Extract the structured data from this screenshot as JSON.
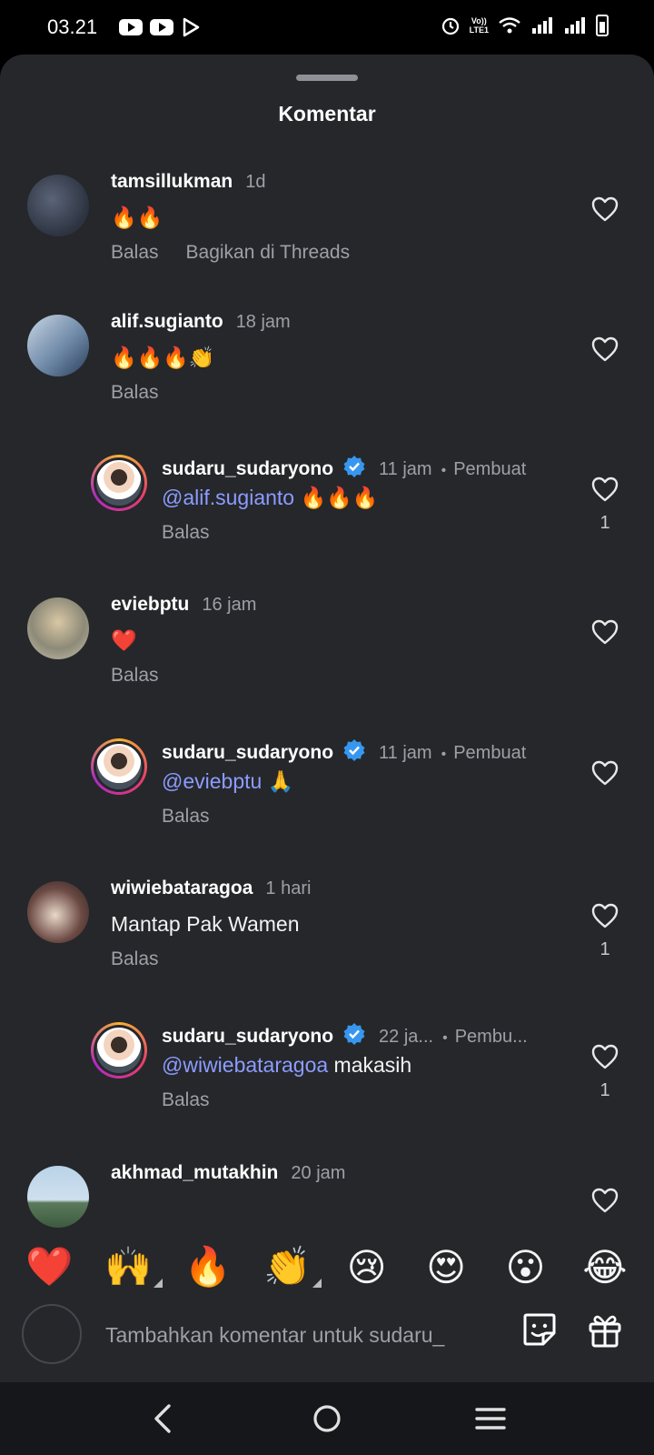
{
  "status_bar": {
    "time": "03.21",
    "lte_label_top": "Vo))",
    "lte_label_bottom": "LTE1"
  },
  "sheet": {
    "title": "Komentar"
  },
  "actions": {
    "reply": "Balas",
    "share_threads": "Bagikan di Threads"
  },
  "comments": [
    {
      "username": "tamsillukman",
      "time": "1d",
      "text": "🔥🔥",
      "show_share": true,
      "likes": ""
    },
    {
      "username": "alif.sugianto",
      "time": "18 jam",
      "text": "🔥🔥🔥👏",
      "likes": ""
    },
    {
      "username": "sudaru_sudaryono",
      "time": "11 jam",
      "author": "Pembuat",
      "mention": "@alif.sugianto",
      "text": " 🔥🔥🔥",
      "likes": "1",
      "reply": true
    },
    {
      "username": "eviebptu",
      "time": "16 jam",
      "text": "❤️",
      "likes": ""
    },
    {
      "username": "sudaru_sudaryono",
      "time": "11 jam",
      "author": "Pembuat",
      "mention": "@eviebptu",
      "text": " 🙏",
      "likes": "",
      "reply": true
    },
    {
      "username": "wiwiebataragoa",
      "time": "1 hari",
      "text": "Mantap Pak Wamen",
      "likes": "1"
    },
    {
      "username": "sudaru_sudaryono",
      "time": "22 ja...",
      "author": "Pembu...",
      "mention": "@wiwiebataragoa",
      "text": " makasih",
      "likes": "1",
      "reply": true
    },
    {
      "username": "akhmad_mutakhin",
      "time": "20 jam",
      "text": "",
      "likes": ""
    }
  ],
  "emoji_bar": [
    "❤️",
    "🙌",
    "🔥",
    "👏",
    "😢",
    "😍",
    "😮",
    "😂"
  ],
  "input": {
    "placeholder": "Tambahkan komentar untuk sudaru_"
  },
  "icons": {
    "heart": "heart-outline-icon",
    "verified": "verified-badge-icon",
    "sticker": "sticker-icon",
    "gift": "gift-icon",
    "back": "nav-back-icon",
    "home": "nav-home-icon",
    "recents": "nav-recents-icon"
  },
  "colors": {
    "background": "#25272b",
    "mention": "#8c9cff",
    "verified": "#3797f0",
    "muted": "#9da0a5"
  }
}
